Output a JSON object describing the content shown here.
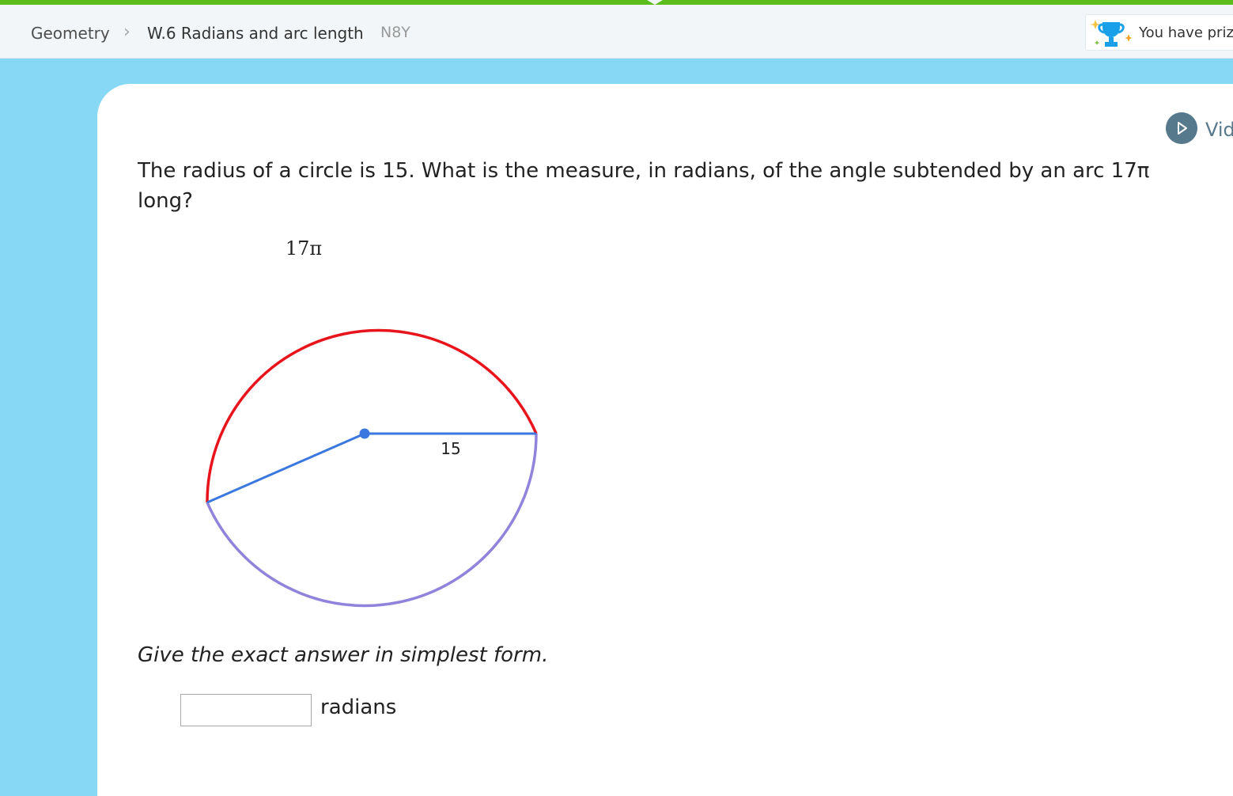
{
  "header": {
    "breadcrumb_root": "Geometry",
    "separator": ">",
    "skill": "W.6 Radians and arc length",
    "skill_code": "N8Y",
    "prize_text": "You have priz"
  },
  "video": {
    "label": "Vid",
    "icon": "play-icon"
  },
  "question": {
    "text": "The radius of a circle is 15. What is the measure, in radians, of the angle subtended by an arc 17π long?"
  },
  "diagram": {
    "arc_label": "17π",
    "radius_label": "15",
    "colors": {
      "arc": "#e8141c",
      "remaining_arc": "#8f83db",
      "radius": "#3a78e0"
    }
  },
  "instruction": "Give the exact answer in simplest form.",
  "answer": {
    "value": "",
    "unit": "radians"
  },
  "colors": {
    "progress": "#5bbd19",
    "background": "#87d8f4",
    "video": "#567a8c"
  }
}
